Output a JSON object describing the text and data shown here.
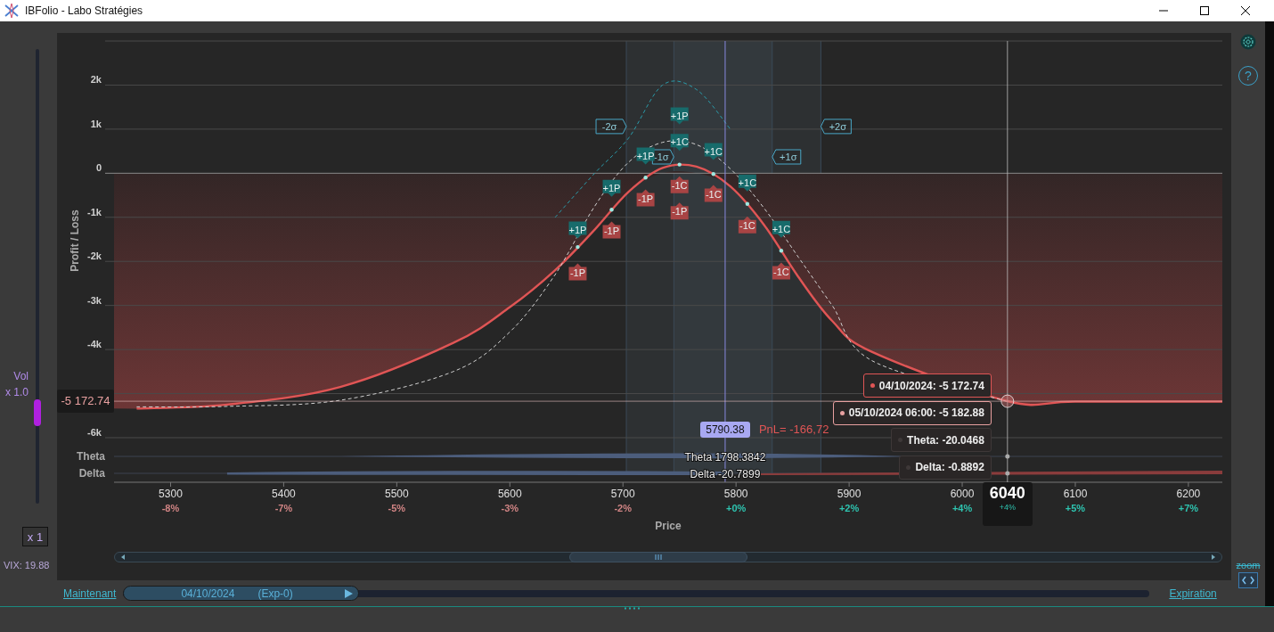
{
  "window": {
    "title": "IBFolio - Labo Stratégies"
  },
  "vol_slider": {
    "label": "Vol",
    "value": "x 1.0",
    "level": 0.2
  },
  "multiplier_button": "x 1",
  "vix": "VIX: 19.88",
  "chart": {
    "pnl": "PnL= -166,72",
    "cursor_change": "+4%",
    "x_changes": [
      {
        "text": "-8%",
        "color": "#d08484"
      },
      {
        "text": "-7%",
        "color": "#d08484"
      },
      {
        "text": "-5%",
        "color": "#d08484"
      },
      {
        "text": "-3%",
        "color": "#d08484"
      },
      {
        "text": "-2%",
        "color": "#d08484"
      },
      {
        "text": "+0%",
        "color": "#2ec4b0"
      },
      {
        "text": "+2%",
        "color": "#2ec4b0"
      },
      {
        "text": "+4%",
        "color": "#2ec4b0"
      },
      {
        "text": "+5%",
        "color": "#2ec4b0"
      },
      {
        "text": "+7%",
        "color": "#2ec4b0"
      }
    ],
    "greeks": [
      {
        "label": "Theta",
        "value": "Theta 1798.3842"
      },
      {
        "label": "Delta",
        "value": "Delta -20.7899"
      }
    ],
    "tooltips": [
      {
        "text": "04/10/2024: -5 172.74",
        "color": "#e05555"
      },
      {
        "text": "05/10/2024 06:00: -5 182.88",
        "color": "#e8a0a0"
      },
      {
        "text": "Theta: -20.0468",
        "color": "#3e3838"
      },
      {
        "text": "Delta: -0.8892",
        "color": "#3e3838"
      }
    ],
    "chart_data": {
      "type": "line",
      "ylabel": "Profit / Loss",
      "xlabel": "Price",
      "grid": true,
      "x": [
        5270,
        5350,
        5450,
        5550,
        5600,
        5640,
        5675,
        5705,
        5735,
        5765,
        5795,
        5825,
        5855,
        5885,
        5920,
        6040,
        6100,
        6230
      ],
      "series": [
        {
          "color": "#e05555",
          "values": [
            -5340,
            -5250,
            -4850,
            -3850,
            -3040,
            -2200,
            -1280,
            -420,
            120,
            150,
            -300,
            -1180,
            -2350,
            -3350,
            -4050,
            -5170,
            -5180,
            -5180
          ]
        },
        {
          "color": "#d0d0d0",
          "line_style": "dashed",
          "values": [
            -5300,
            -5290,
            -5150,
            -4500,
            -3600,
            -2300,
            -750,
            250,
            700,
            650,
            100,
            -800,
            -1900,
            -3000,
            -4250,
            -5180,
            null,
            null
          ]
        },
        {
          "color": "#2a9cab",
          "line_style": "dashed",
          "values": [
            null,
            null,
            null,
            null,
            null,
            -1000,
            0,
            800,
            2000,
            1900,
            1000,
            null,
            null,
            null,
            null,
            null,
            null,
            null
          ]
        }
      ],
      "xlim": [
        5250,
        6230
      ],
      "ylim": [
        -6000,
        3000
      ],
      "xticks": [
        5300,
        5400,
        5500,
        5600,
        5700,
        5800,
        5900,
        6000,
        6100,
        6200
      ],
      "yticks": [
        {
          "value": 2000,
          "label": "2k"
        },
        {
          "value": 1000,
          "label": "1k"
        },
        {
          "value": 0,
          "label": "0"
        },
        {
          "value": -1000,
          "label": "-1k"
        },
        {
          "value": -2000,
          "label": "-2k"
        },
        {
          "value": -3000,
          "label": "-3k"
        },
        {
          "value": -4000,
          "label": "-4k"
        },
        {
          "value": -6000,
          "label": "-6k"
        }
      ],
      "ref_lines": [
        {
          "axis": "x",
          "value": 5703,
          "label": "-2σ"
        },
        {
          "axis": "x",
          "value": 5745,
          "label": "-1σ"
        },
        {
          "axis": "x",
          "value": 5832,
          "label": "+1σ"
        },
        {
          "axis": "x",
          "value": 5875,
          "label": "+2σ"
        },
        {
          "axis": "x",
          "value": 5790.38,
          "label": "5790.38"
        },
        {
          "axis": "x",
          "value": 6040,
          "label": "6040"
        },
        {
          "axis": "y",
          "value": -5172.74,
          "label": "-5 172.74"
        }
      ],
      "annotations": [
        {
          "x": 5660,
          "y": -1280,
          "text": "+1P"
        },
        {
          "x": 5660,
          "y": -2250,
          "text": "-1P"
        },
        {
          "x": 5690,
          "y": -330,
          "text": "+1P"
        },
        {
          "x": 5690,
          "y": -1300,
          "text": "-1P"
        },
        {
          "x": 5720,
          "y": 400,
          "text": "+1P"
        },
        {
          "x": 5720,
          "y": -570,
          "text": "-1P"
        },
        {
          "x": 5750,
          "y": 1310,
          "text": "+1P"
        },
        {
          "x": 5750,
          "y": 710,
          "text": "+1C"
        },
        {
          "x": 5750,
          "y": -270,
          "text": "-1C"
        },
        {
          "x": 5750,
          "y": -870,
          "text": "-1P"
        },
        {
          "x": 5780,
          "y": 500,
          "text": "+1C"
        },
        {
          "x": 5780,
          "y": -470,
          "text": "-1C"
        },
        {
          "x": 5810,
          "y": -210,
          "text": "+1C"
        },
        {
          "x": 5810,
          "y": -1180,
          "text": "-1C"
        },
        {
          "x": 5840,
          "y": -1260,
          "text": "+1C"
        },
        {
          "x": 5840,
          "y": -2230,
          "text": "-1C"
        }
      ]
    }
  },
  "timeline": {
    "start": "Maintenant",
    "date": "04/10/2024",
    "expiry": "(Exp-0)",
    "level": 0.23,
    "end": "Expiration"
  },
  "toolbar": {
    "help": "?",
    "zoom": "zoom"
  }
}
